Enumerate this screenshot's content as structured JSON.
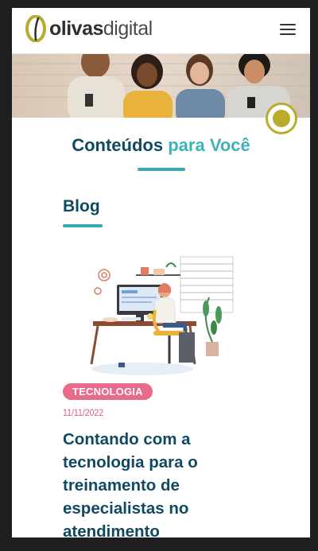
{
  "brand": {
    "name_part1": "olivas",
    "name_part2": "digital",
    "mark_color": "#b7ac2b"
  },
  "header": {
    "menu_icon": "hamburger-menu-icon"
  },
  "hero": {
    "image": "people-using-smartphones-photo",
    "floating_icon": "record-circle-icon",
    "accent": "#b7ac2b"
  },
  "section": {
    "title_part1": "Conteúdos",
    "title_part2": "para Você",
    "title_color": "#0f4a62",
    "accent_color": "#3fb1bd"
  },
  "blog": {
    "heading": "Blog",
    "post": {
      "illustration": "woman-working-at-desk-illustration",
      "tag": "TECNOLOGIA",
      "tag_color": "#e86b8c",
      "date": "11/11/2022",
      "title": "Contando com a tecnologia para o treinamento de especialistas no atendimento"
    }
  }
}
